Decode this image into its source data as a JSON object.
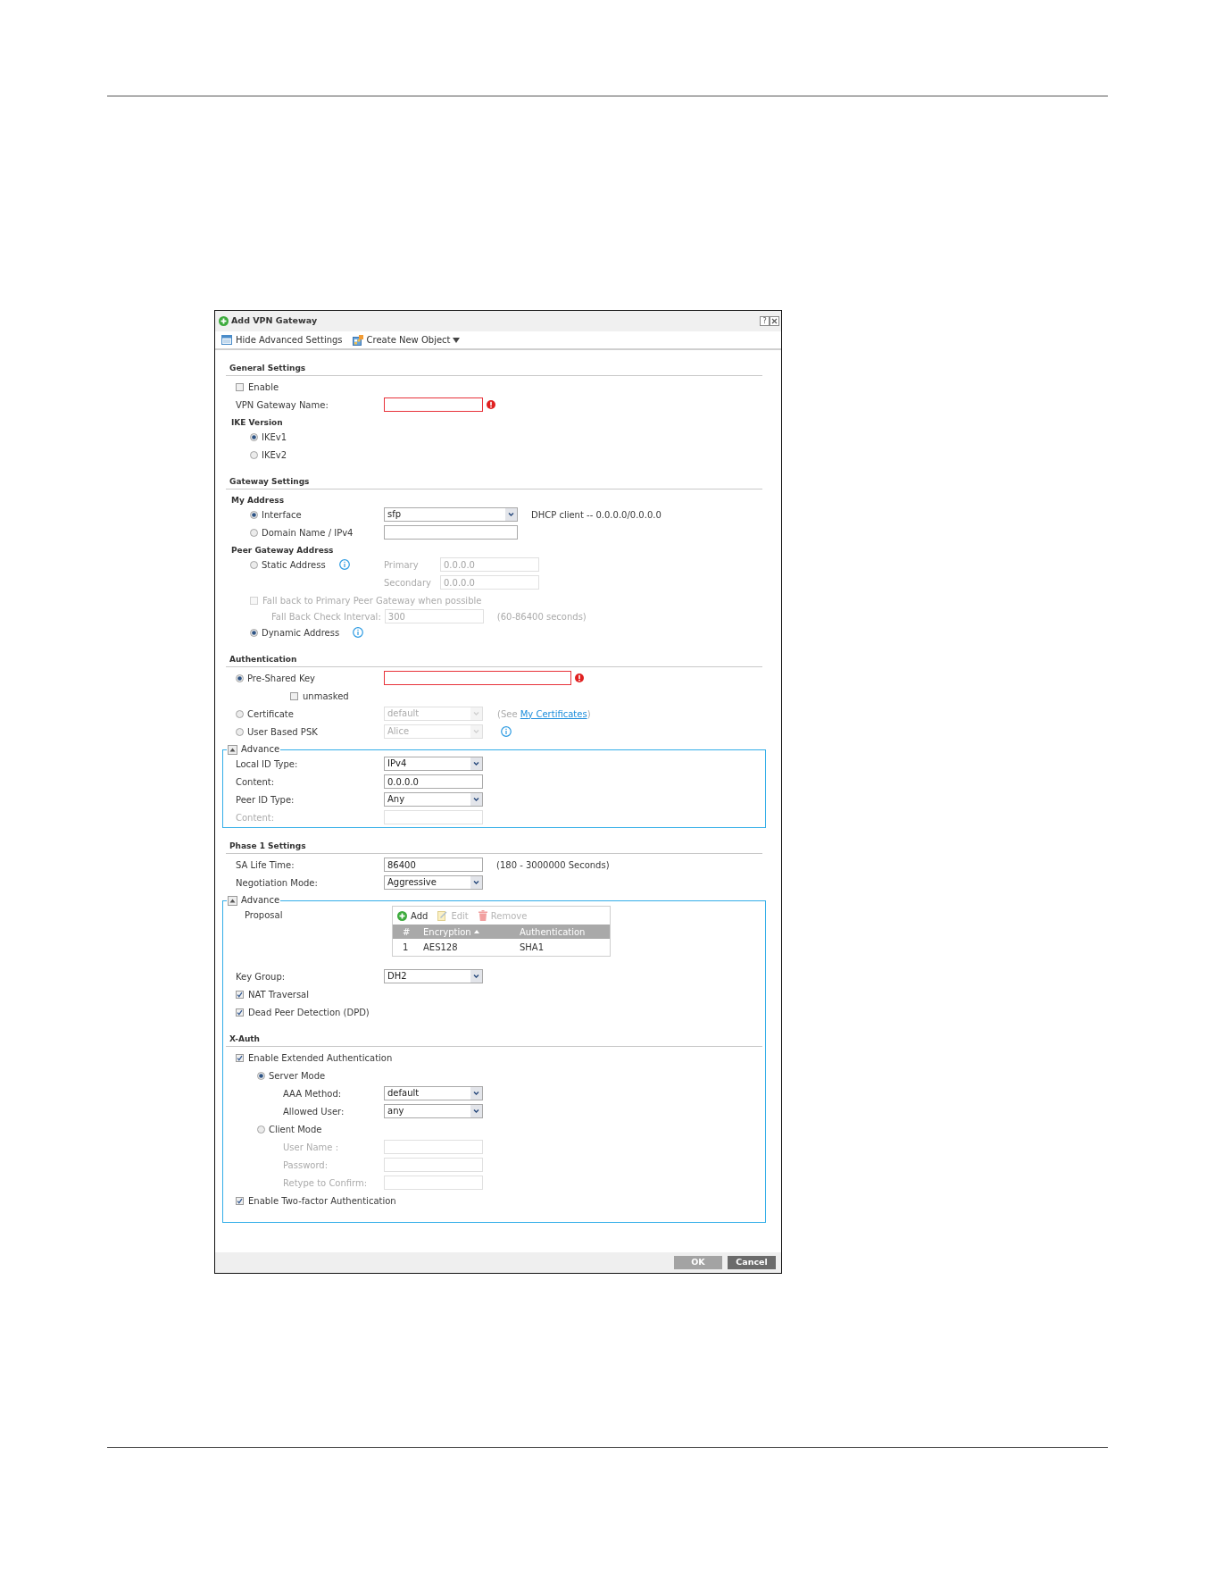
{
  "dialog": {
    "title": "Add VPN Gateway",
    "title_buttons": [
      {
        "kind": "help",
        "label": "?"
      },
      {
        "kind": "close"
      }
    ]
  },
  "toolbar": [
    {
      "kind": "toggle",
      "label": "Hide Advanced Settings"
    },
    {
      "kind": "menu",
      "label": "Create New Object"
    }
  ],
  "sections": [
    {
      "title": "General Settings",
      "rows": [
        {
          "kind": "checkbox",
          "label": "Enable",
          "checked": false
        },
        {
          "kind": "field",
          "label": "VPN Gateway Name:",
          "error": true
        },
        {
          "kind": "group",
          "label": "IKE Version",
          "children": [
            {
              "kind": "radio",
              "label": "IKEv1",
              "selected": true
            },
            {
              "kind": "radio",
              "label": "IKEv2",
              "selected": false
            }
          ]
        }
      ]
    },
    {
      "title": "Gateway Settings",
      "rows": [
        {
          "kind": "group",
          "label": "My Address",
          "children": [
            {
              "kind": "radio",
              "label": "Interface",
              "selected": true,
              "control": {
                "kind": "select",
                "value": "sfp",
                "disabled": false
              },
              "note": "DHCP client -- 0.0.0.0/0.0.0.0"
            },
            {
              "kind": "radio",
              "label": "Domain Name / IPv4",
              "selected": false,
              "control": {
                "kind": "input",
                "disabled": false
              }
            }
          ]
        },
        {
          "kind": "group",
          "label": "Peer Gateway Address",
          "children": [
            {
              "kind": "radio",
              "label": "Static Address",
              "selected": false,
              "info": true,
              "fields": [
                {
                  "label": "Primary",
                  "value": "0.0.0.0",
                  "disabled": true
                },
                {
                  "label": "Secondary",
                  "value": "0.0.0.0",
                  "disabled": true
                }
              ]
            },
            {
              "kind": "checkbox",
              "label": "Fall back to Primary Peer Gateway when possible",
              "checked": false,
              "disabled": true,
              "children": [
                {
                  "kind": "field",
                  "label": "Fall Back Check Interval:",
                  "value": "300",
                  "disabled": true,
                  "note": "(60-86400 seconds)"
                }
              ]
            },
            {
              "kind": "radio",
              "label": "Dynamic Address",
              "selected": true,
              "info": true
            }
          ]
        }
      ]
    },
    {
      "title": "Authentication",
      "rows": [
        {
          "kind": "radio",
          "label": "Pre-Shared Key",
          "selected": true,
          "control": {
            "kind": "password",
            "error": true
          },
          "option": {
            "label": "unmasked",
            "checked": false
          }
        },
        {
          "kind": "radio",
          "label": "Certificate",
          "selected": false,
          "control": {
            "kind": "select",
            "value": "default",
            "disabled": true
          },
          "hint": {
            "text": "(See ",
            "link": "My Certificates",
            "end": ")"
          }
        },
        {
          "kind": "radio",
          "label": "User Based PSK",
          "selected": false,
          "control": {
            "kind": "select",
            "value": "Alice",
            "disabled": true
          },
          "info": true
        },
        {
          "kind": "advance",
          "label": "Advance",
          "expanded": true,
          "rows": [
            {
              "kind": "select",
              "label": "Local ID Type:",
              "value": "IPv4"
            },
            {
              "kind": "field",
              "label": "Content:",
              "value": "0.0.0.0"
            },
            {
              "kind": "select",
              "label": "Peer ID Type:",
              "value": "Any"
            },
            {
              "kind": "field",
              "label": "Content:",
              "disabled": true
            }
          ]
        }
      ]
    },
    {
      "title": "Phase 1 Settings",
      "rows": [
        {
          "kind": "field",
          "label": "SA Life Time:",
          "value": "86400",
          "note": "(180 - 3000000 Seconds)"
        },
        {
          "kind": "select",
          "label": "Negotiation Mode:",
          "value": "Aggressive"
        },
        {
          "kind": "advance",
          "label": "Advance",
          "expanded": true,
          "rows": [
            {
              "kind": "table",
              "label": "Proposal",
              "tools": [
                {
                  "kind": "add",
                  "label": "Add",
                  "disabled": false
                },
                {
                  "kind": "edit",
                  "label": "Edit",
                  "disabled": true
                },
                {
                  "kind": "remove",
                  "label": "Remove",
                  "disabled": true
                }
              ],
              "columns": [
                {
                  "label": "#",
                  "sorted": false
                },
                {
                  "label": "Encryption",
                  "sorted": true
                },
                {
                  "label": "Authentication",
                  "sorted": false
                }
              ],
              "rows": [
                [
                  "1",
                  "AES128",
                  "SHA1"
                ]
              ]
            },
            {
              "kind": "select",
              "label": "Key Group:",
              "value": "DH2"
            },
            {
              "kind": "checkbox",
              "label": "NAT Traversal",
              "checked": true
            },
            {
              "kind": "checkbox",
              "label": "Dead Peer Detection (DPD)",
              "checked": true
            },
            {
              "kind": "section",
              "title": "X-Auth",
              "rows": [
                {
                  "kind": "checkbox",
                  "label": "Enable Extended Authentication",
                  "checked": true,
                  "children": [
                    {
                      "kind": "radio",
                      "label": "Server Mode",
                      "selected": true,
                      "children": [
                        {
                          "kind": "select",
                          "label": "AAA Method:",
                          "value": "default"
                        },
                        {
                          "kind": "select",
                          "label": "Allowed User:",
                          "value": "any"
                        }
                      ]
                    },
                    {
                      "kind": "radio",
                      "label": "Client Mode",
                      "selected": false,
                      "children": [
                        {
                          "kind": "field",
                          "label": "User Name :",
                          "disabled": true
                        },
                        {
                          "kind": "field",
                          "label": "Password:",
                          "disabled": true
                        },
                        {
                          "kind": "field",
                          "label": "Retype to Confirm:",
                          "disabled": true
                        }
                      ]
                    }
                  ]
                },
                {
                  "kind": "checkbox",
                  "label": "Enable Two-factor Authentication",
                  "checked": true
                }
              ]
            }
          ]
        }
      ]
    }
  ],
  "buttons": [
    {
      "label": "OK",
      "disabled": true
    },
    {
      "label": "Cancel",
      "disabled": false
    }
  ]
}
